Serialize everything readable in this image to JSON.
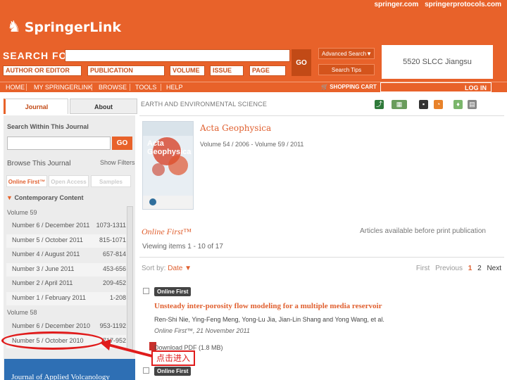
{
  "header": {
    "top_links": [
      "springer.com",
      "springerprotocols.com"
    ],
    "logo_text": "SpringerLink",
    "search_label": "SEARCH FOR",
    "search_value": "",
    "fields": [
      "AUTHOR OR EDITOR",
      "PUBLICATION",
      "VOLUME",
      "ISSUE",
      "PAGE"
    ],
    "go_label": "GO",
    "advanced_search_label": "Advanced Search",
    "search_tips_label": "Search Tips",
    "institution": "5520 SLCC Jiangsu"
  },
  "nav": {
    "items": [
      "HOME",
      "MY SPRINGERLINK",
      "BROWSE",
      "TOOLS",
      "HELP"
    ],
    "cart_label": "SHOPPING CART",
    "login_label": "LOG IN"
  },
  "sidebar": {
    "tabs": [
      "Journal",
      "About"
    ],
    "search_within_label": "Search Within This Journal",
    "search_go_label": "GO",
    "browse_label": "Browse This Journal",
    "show_filters_label": "Show Filters",
    "filter_tabs": [
      "Online First™",
      "Open Access",
      "Samples"
    ],
    "contemporary_label": "Contemporary Content",
    "volumes": [
      {
        "label": "Volume 59",
        "issues": [
          {
            "name": "Number 6 / December 2011",
            "pages": "1073-1311"
          },
          {
            "name": "Number 5 / October 2011",
            "pages": "815-1071"
          },
          {
            "name": "Number 4 / August 2011",
            "pages": "657-814"
          },
          {
            "name": "Number 3 / June 2011",
            "pages": "453-656"
          },
          {
            "name": "Number 2 / April 2011",
            "pages": "209-452"
          },
          {
            "name": "Number 1 / February 2011",
            "pages": "1-208"
          }
        ]
      },
      {
        "label": "Volume 58",
        "issues": [
          {
            "name": "Number 6 / December 2010",
            "pages": "953-1192"
          },
          {
            "name": "Number 5 / October 2010",
            "pages": "717-952"
          }
        ]
      }
    ],
    "ad_text": "Journal of Applied Volcanology"
  },
  "main": {
    "subject": "EARTH AND ENVIRONMENTAL SCIENCE",
    "cover_title_line1": "Acta",
    "cover_title_line2": "Geophysica",
    "journal_title": "Acta Geophysica",
    "volume_range": "Volume 54 / 2006 - Volume 59 / 2011",
    "online_first_title": "Online First™",
    "online_first_desc": "Articles available before print publication",
    "viewing": "Viewing items 1 - 10 of 17",
    "sort_label": "Sort by:",
    "sort_value": "Date ▼",
    "pager": {
      "first": "First",
      "previous": "Previous",
      "current": "1",
      "page2": "2",
      "next": "Next"
    },
    "article": {
      "badge": "Online First",
      "title": "Unsteady inter-porosity flow modeling for a multiple media reservoir",
      "authors": "Ren-Shi Nie, Ying-Feng Meng, Yong-Lu Jia, Jian-Lin Shang and Yong Wang, et al.",
      "published": "Online First™, 21 November 2011",
      "download": "Download PDF (1.8 MB)"
    },
    "next_badge": "Online First"
  },
  "annotation": {
    "callout_text": "点击进入",
    "color": "#e01b1b"
  },
  "colors": {
    "brand": "#e8622a",
    "link": "#e06030"
  }
}
